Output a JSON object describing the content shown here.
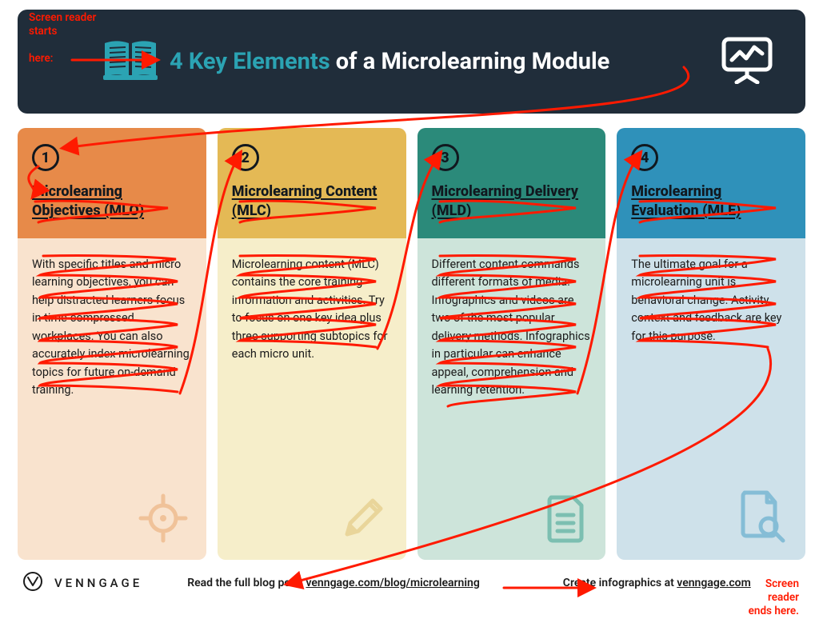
{
  "header": {
    "title_accent": "4 Key Elements",
    "title_rest": " of a Microlearning Module"
  },
  "annotations": {
    "start_line1": "Screen reader",
    "start_line2": "starts",
    "start_line3": "here:",
    "end_line1": "Screen",
    "end_line2": "reader",
    "end_line3": "ends here."
  },
  "columns": [
    {
      "num": "1",
      "title": "Microlearning Objectives (MLO)",
      "body": "With specific titles and micro learning objectives, you can help distracted learners focus in time-compressed workplaces. You can also accurately index microlearning topics for future on-demand training.",
      "icon": "crosshair-icon",
      "icon_color": "#e9a86f"
    },
    {
      "num": "2",
      "title": "Microlearning Content (MLC)",
      "body": "Microlearning content (MLC) contains the core training information and activities. Try to focus on one key idea plus three supporting subtopics for each micro unit.",
      "icon": "pencil-icon",
      "icon_color": "#e0c273"
    },
    {
      "num": "3",
      "title": "Microlearning Delivery (MLD)",
      "body": "Different content commands different formats of media. Infographics and videos are two of the most popular delivery methods. Infographics in particular can enhance appeal, comprehension and learning retention.",
      "icon": "document-icon",
      "icon_color": "#3aa191"
    },
    {
      "num": "4",
      "title": "Microlearning Evaluation (MLE)",
      "body": "The ultimate goal for a microlearning unit is behavioral change. Activity, context and feedback are key for this purpose.",
      "icon": "file-search-icon",
      "icon_color": "#4ba0c6"
    }
  ],
  "footer": {
    "brand": "VENNGAGE",
    "blog_prefix": "Read the full blog post: ",
    "blog_link": "venngage.com/blog/microlearning",
    "create_prefix": "Create infographics at ",
    "create_link": "venngage.com"
  }
}
